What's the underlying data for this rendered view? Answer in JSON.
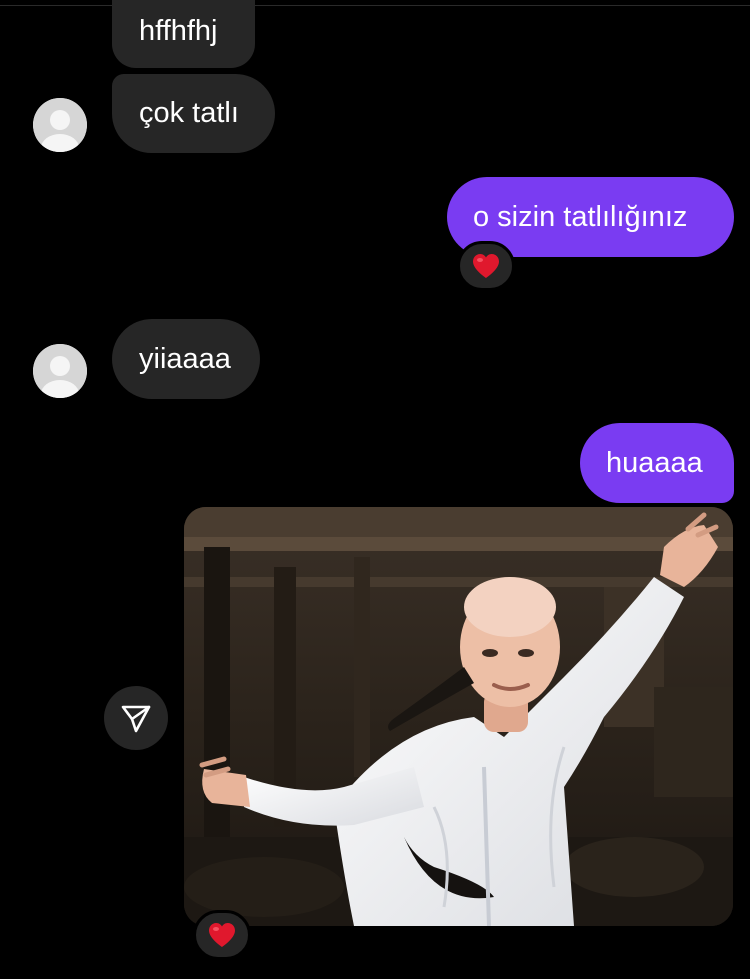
{
  "messages": {
    "m1": {
      "text": "hffhfhj",
      "direction": "received"
    },
    "m2": {
      "text": "çok tatlı",
      "direction": "received"
    },
    "m3": {
      "text": "o sizin tatlılığınız",
      "direction": "sent",
      "reaction": "heart-emoji"
    },
    "m4": {
      "text": "yiiaaaa",
      "direction": "received"
    },
    "m5": {
      "text": "huaaaa",
      "direction": "sent"
    },
    "m6": {
      "type": "photo",
      "direction": "sent",
      "reaction": "heart-emoji"
    }
  },
  "icons": {
    "avatar": "default-avatar-icon",
    "share": "paper-plane-icon",
    "reaction": "red-heart-emoji"
  },
  "colors": {
    "background": "#000000",
    "received_bubble": "#262626",
    "sent_bubble": "#7a3cf2",
    "text": "#ffffff",
    "heart": "#e0182d"
  }
}
